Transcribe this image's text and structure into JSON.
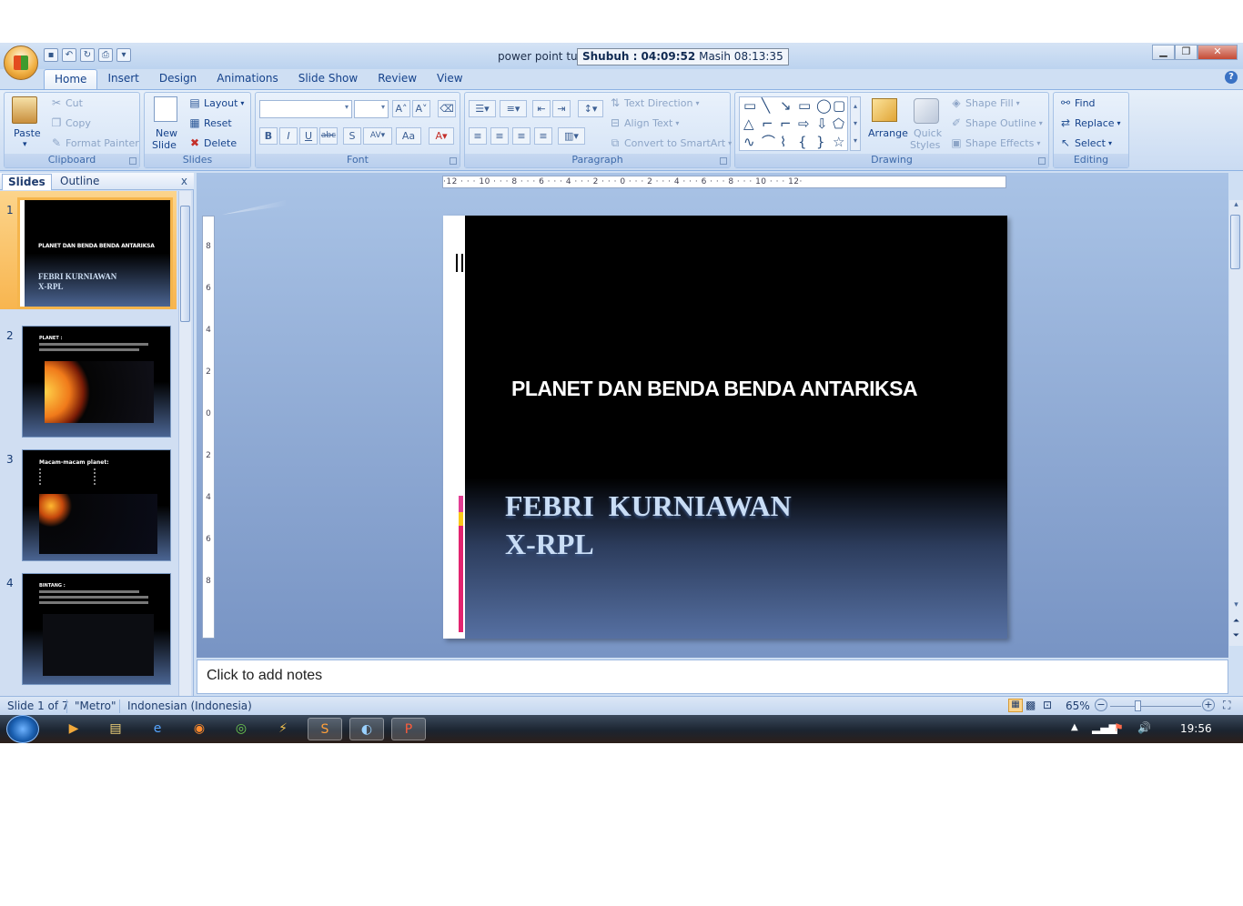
{
  "window": {
    "title": "power point tug",
    "clock_label": "Shubuh : 04:09:52",
    "clock_remaining": "Masih 08:13:35",
    "controls": {
      "minimize": "▁",
      "restore": "❐",
      "close": "✕"
    }
  },
  "tabs": [
    "Home",
    "Insert",
    "Design",
    "Animations",
    "Slide Show",
    "Review",
    "View"
  ],
  "ribbon": {
    "clipboard": {
      "label": "Clipboard",
      "paste": "Paste",
      "cut": "Cut",
      "copy": "Copy",
      "format_painter": "Format Painter"
    },
    "slides": {
      "label": "Slides",
      "new_slide_1": "New",
      "new_slide_2": "Slide",
      "layout": "Layout",
      "reset": "Reset",
      "delete": "Delete"
    },
    "font": {
      "label": "Font"
    },
    "paragraph": {
      "label": "Paragraph",
      "text_direction": "Text Direction",
      "align_text": "Align Text",
      "convert_smartart": "Convert to SmartArt"
    },
    "drawing": {
      "label": "Drawing",
      "arrange": "Arrange",
      "quick_styles_1": "Quick",
      "quick_styles_2": "Styles",
      "shape_fill": "Shape Fill",
      "shape_outline": "Shape Outline",
      "shape_effects": "Shape Effects"
    },
    "editing": {
      "label": "Editing",
      "find": "Find",
      "replace": "Replace",
      "select": "Select"
    }
  },
  "pane": {
    "tab_slides": "Slides",
    "tab_outline": "Outline",
    "close": "x",
    "thumbnails": [
      {
        "num": "1",
        "title": "PLANET DAN BENDA BENDA ANTARIKSA",
        "sub1": "FEBRI  KURNIAWAN",
        "sub2": "X-RPL"
      },
      {
        "num": "2",
        "title": "PLANET :"
      },
      {
        "num": "3",
        "title": "Macam-macam planet:"
      },
      {
        "num": "4",
        "title": "BINTANG :"
      }
    ]
  },
  "slide": {
    "title": "PLANET DAN BENDA BENDA ANTARIKSA",
    "subtitle": "FEBRI  KURNIAWAN\nX-RPL"
  },
  "ruler": {
    "horizontal": "·12 · · · 10 · · · 8 · · · 6 · · · 4 · · · 2 · · · 0 · · · 2 · · · 4 · · · 6 · · · 8 · · · 10 · · · 12·",
    "vertical": [
      "8",
      "6",
      "4",
      "2",
      "0",
      "2",
      "4",
      "6",
      "8"
    ]
  },
  "notes": {
    "placeholder": "Click to add notes"
  },
  "status": {
    "slide_of": "Slide 1 of 7",
    "theme": "\"Metro\"",
    "language": "Indonesian (Indonesia)",
    "zoom": "65%"
  },
  "taskbar": {
    "time": "19:56"
  }
}
